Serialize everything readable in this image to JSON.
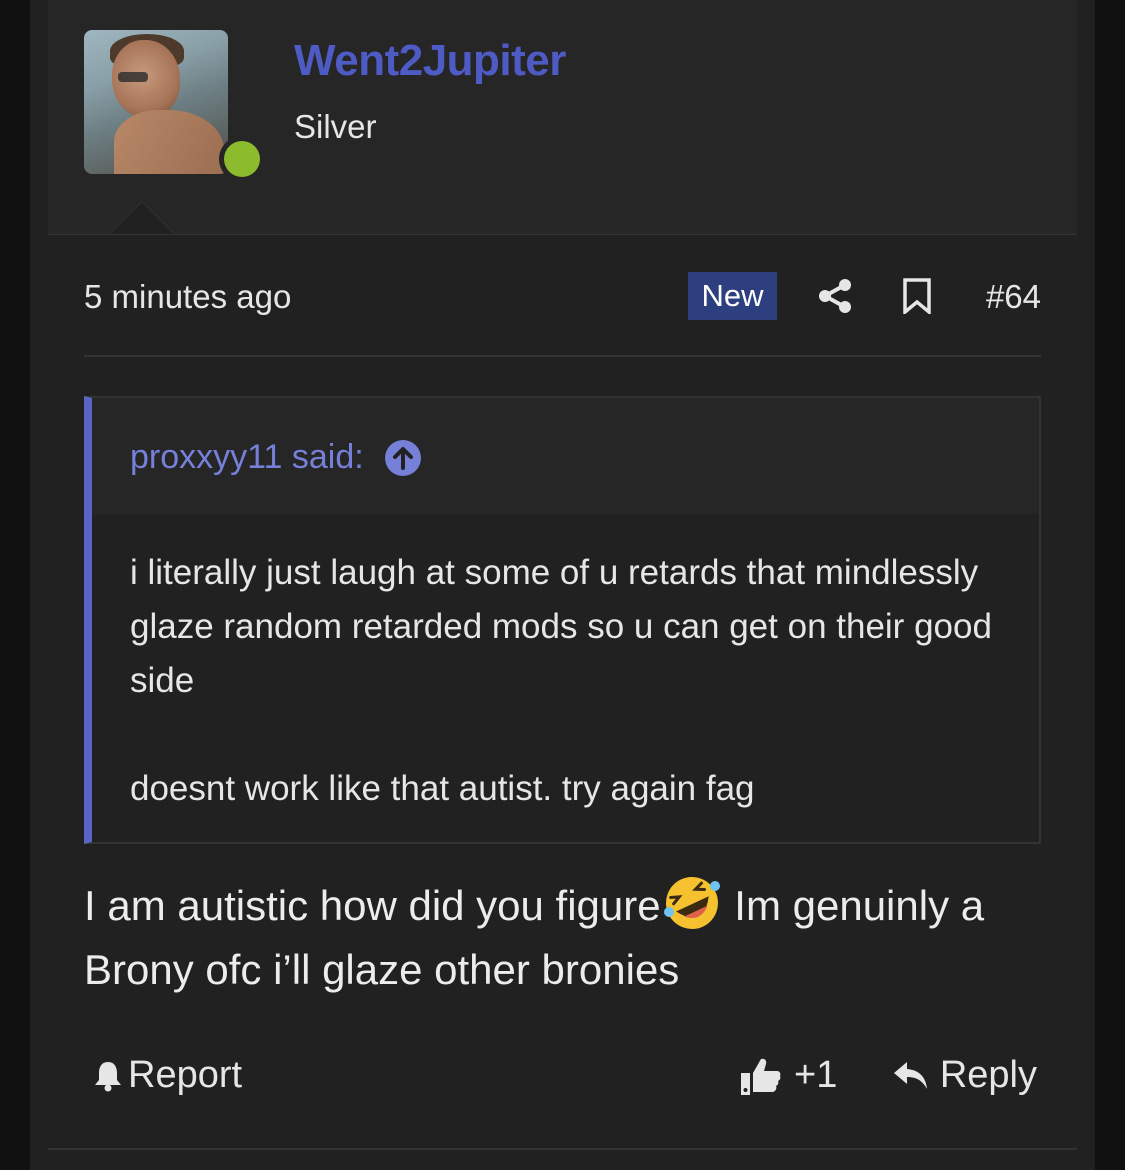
{
  "post": {
    "author": {
      "username": "Went2Jupiter",
      "rank": "Silver",
      "online": true
    },
    "timestamp": "5 minutes ago",
    "badge": "New",
    "post_number": "#64",
    "icons": [
      "share-icon",
      "bookmark-icon"
    ],
    "quote": {
      "author_line": "proxxyy11 said:",
      "paragraphs": [
        "i literally just laugh at some of u retards that mindlessly glaze random retarded mods so u can get on their good side",
        "doesnt work like that autist. try again fag"
      ]
    },
    "message": {
      "before_emoji": "I am autistic how did you figure",
      "emoji": "rolling-on-floor-laughing-emoji",
      "after_emoji": " Im genuinly a Brony ofc i’ll glaze other bronies"
    },
    "actions": {
      "report_label": "Report",
      "like_label": "+1",
      "reply_label": "Reply"
    },
    "colors": {
      "username": "#4f5bc4",
      "badge_bg": "#2e3f80",
      "quote_accent": "#5a64c4",
      "online_dot": "#8dbb2e"
    }
  }
}
